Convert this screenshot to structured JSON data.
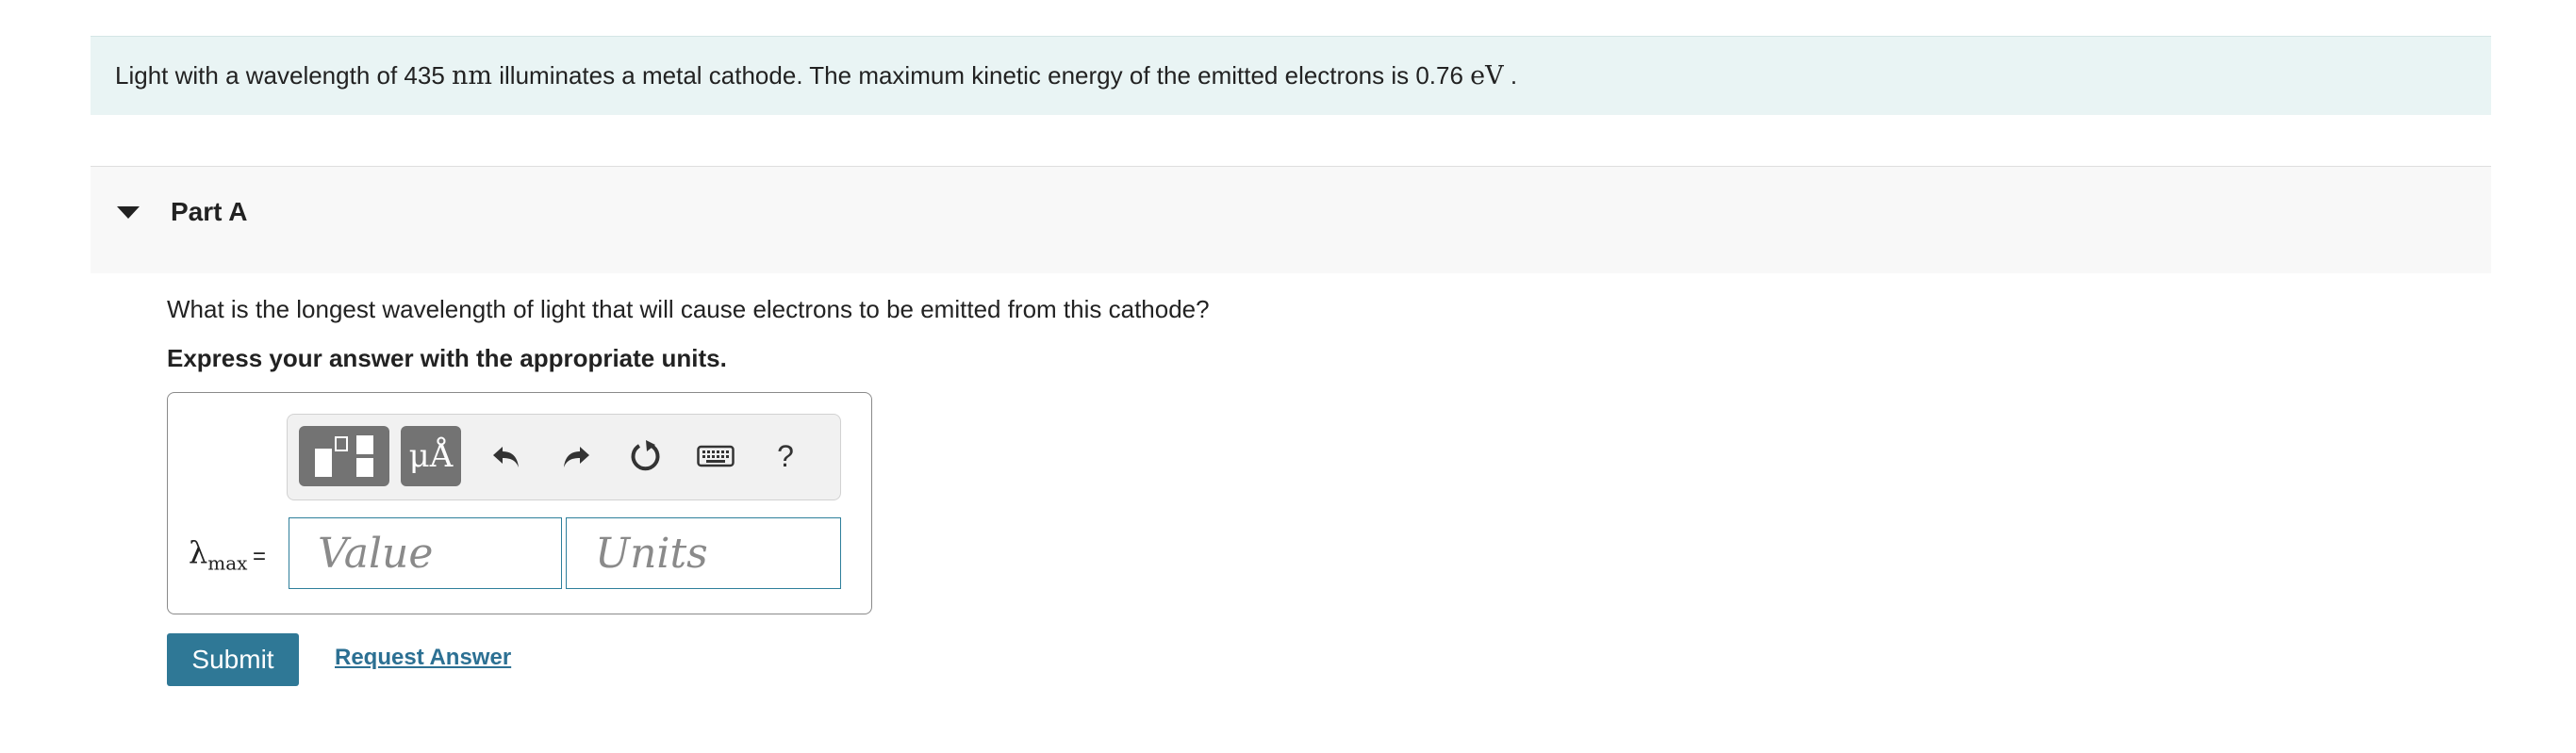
{
  "problem": {
    "prefix": "Light with a wavelength of 435 ",
    "unit_nm": "nm",
    "middle": " illuminates a metal cathode. The maximum kinetic energy of the emitted electrons is 0.76 ",
    "unit_ev": "eV",
    "suffix": " ."
  },
  "part": {
    "title": "Part A"
  },
  "question": "What is the longest wavelength of light that will cause electrons to be emitted from this cathode?",
  "instruction": "Express your answer with the appropriate units.",
  "toolbar": {
    "units_label": "μÅ",
    "help_label": "?",
    "icons": [
      "templates-icon",
      "units-icon",
      "undo-icon",
      "redo-icon",
      "reset-icon",
      "keyboard-icon",
      "help-icon"
    ]
  },
  "answer": {
    "variable": "λ",
    "subscript": "max",
    "equals": "=",
    "value_placeholder": "Value",
    "units_placeholder": "Units"
  },
  "actions": {
    "submit": "Submit",
    "request": "Request Answer"
  },
  "colors": {
    "accent": "#2f7896",
    "link": "#2c7093",
    "problem_bg": "#e9f4f4",
    "field_border": "#2e7f9b"
  }
}
